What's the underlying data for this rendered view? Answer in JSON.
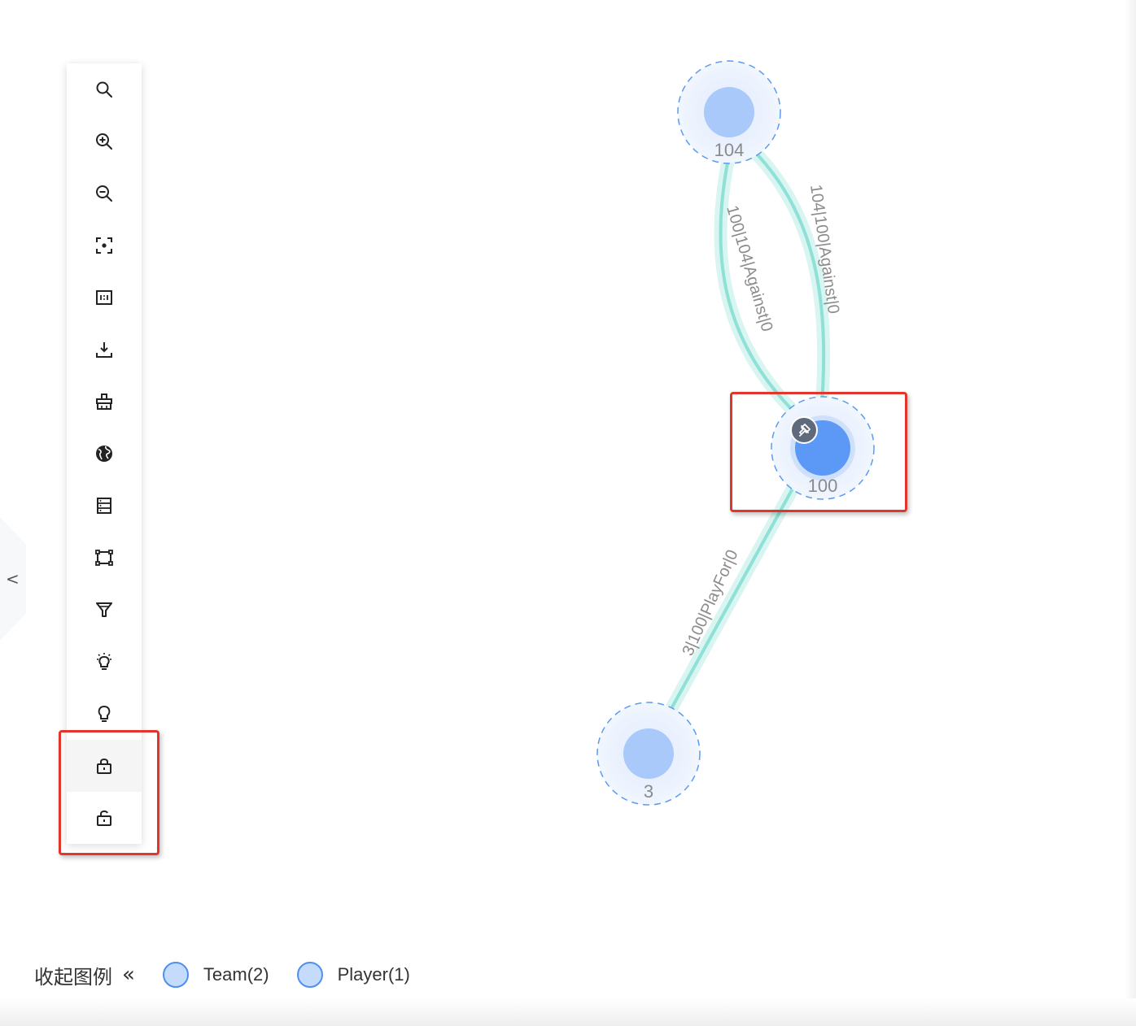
{
  "graph": {
    "nodes": [
      {
        "id": "104",
        "label": "104"
      },
      {
        "id": "100",
        "label": "100"
      },
      {
        "id": "3",
        "label": "3"
      }
    ],
    "edges": [
      {
        "label": "100|104|Against|0"
      },
      {
        "label": "104|100|Against|0"
      },
      {
        "label": "3|100|PlayFor|0"
      }
    ]
  },
  "toolbar": {
    "items": [
      {
        "icon": "search-icon"
      },
      {
        "icon": "zoom-in-icon"
      },
      {
        "icon": "zoom-out-icon"
      },
      {
        "icon": "focus-icon"
      },
      {
        "icon": "actual-size-icon"
      },
      {
        "icon": "download-icon"
      },
      {
        "icon": "clear-icon"
      },
      {
        "icon": "globe-icon"
      },
      {
        "icon": "list-icon"
      },
      {
        "icon": "select-box-icon"
      },
      {
        "icon": "filter-icon"
      },
      {
        "icon": "bulb-on-icon"
      },
      {
        "icon": "bulb-off-icon"
      },
      {
        "icon": "lock-icon"
      },
      {
        "icon": "unlock-icon"
      }
    ]
  },
  "legend": {
    "toggle_label": "收起图例",
    "items": [
      {
        "label": "Team(2)",
        "color": "#c5dbfb"
      },
      {
        "label": "Player(1)",
        "color": "#c5dbfb"
      }
    ]
  },
  "colors": {
    "node_fill": "#a9c9fb",
    "node_selected": "#5c98f6",
    "edge": "#8fe0d6",
    "highlight": "#e0362c"
  }
}
